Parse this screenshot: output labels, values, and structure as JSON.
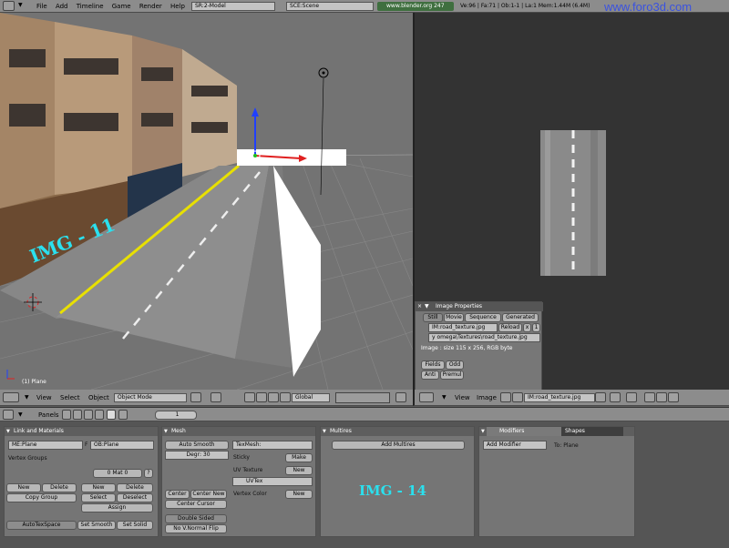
{
  "topbar": {
    "menus": [
      "File",
      "Add",
      "Timeline",
      "Game",
      "Render",
      "Help"
    ],
    "screen": "SR:2-Model",
    "scene": "SCE:Scene",
    "url": "www.blender.org 247",
    "stats": "Ve:96 | Fa:71 | Ob:1-1 | La:1  Mem:1.44M (6.4M)",
    "site": "www.foro3d.com"
  },
  "viewport": {
    "object_label": "(1) Plane",
    "watermark": "IMG - 11",
    "menus": [
      "View",
      "Select",
      "Object"
    ],
    "mode": "Object Mode",
    "orientation": "Global"
  },
  "image_editor": {
    "panel_title": "Image Properties",
    "tabs": [
      "Still",
      "Movie",
      "Sequence",
      "Generated"
    ],
    "image_name": "IM:road_texture.jpg",
    "reload": "Reload",
    "close": "x",
    "users": "1",
    "path": "y omega\\Textures\\road_texture.jpg",
    "info": "Image : size 115 x 256, RGB byte",
    "fields": "Fields",
    "odd": "Odd",
    "anti": "Anti",
    "premul": "Premul",
    "menus": [
      "View",
      "Image"
    ],
    "image_field": "IM:road_texture.jpg"
  },
  "buttons_header": {
    "panels": "Panels",
    "frame": "1"
  },
  "link_materials": {
    "title": "Link and Materials",
    "mesh": "ME:Plane",
    "f": "F",
    "object": "OB:Plane",
    "vertex_groups": "Vertex Groups",
    "mat": "0 Mat 0",
    "q": "?",
    "new": "New",
    "delete": "Delete",
    "copy_group": "Copy Group",
    "new2": "New",
    "delete2": "Delete",
    "select": "Select",
    "deselect": "Deselect",
    "assign": "Assign",
    "autotex": "AutoTexSpace",
    "set_smooth": "Set Smooth",
    "set_solid": "Set Solid"
  },
  "mesh": {
    "title": "Mesh",
    "auto_smooth": "Auto Smooth",
    "degr": "Degr: 30",
    "texmesh": "TexMesh:",
    "sticky": "Sticky",
    "make": "Make",
    "uv_texture": "UV Texture",
    "new": "New",
    "uvtex": "UVTex",
    "vertex_color": "Vertex Color",
    "new2": "New",
    "center": "Center",
    "center_new": "Center New",
    "center_cursor": "Center Cursor",
    "double_sided": "Double Sided",
    "no_vnormal": "No V.Normal Flip"
  },
  "multires": {
    "title": "Multires",
    "add": "Add Multires",
    "watermark": "IMG - 14"
  },
  "modifiers": {
    "tab1": "Modifiers",
    "tab2": "Shapes",
    "add": "Add Modifier",
    "to": "To: Plane"
  }
}
